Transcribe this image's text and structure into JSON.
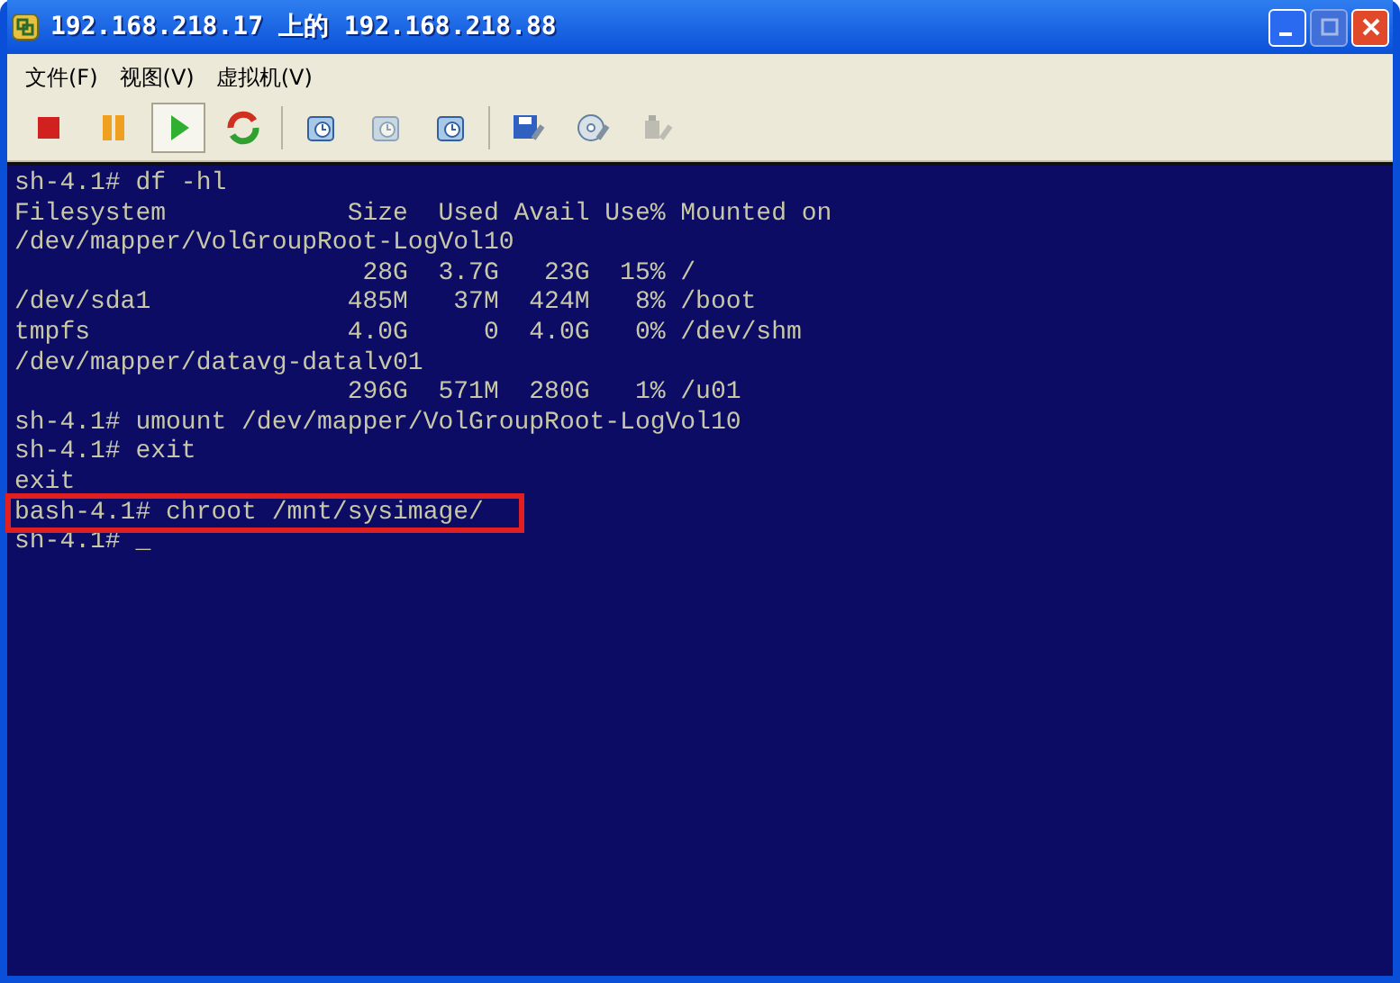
{
  "window": {
    "title": "192.168.218.17 上的 192.168.218.88"
  },
  "menu": [
    "文件(F)",
    "视图(V)",
    "虚拟机(V)"
  ],
  "toolbar": [
    {
      "kind": "stop",
      "selected": false,
      "disabled": false
    },
    {
      "kind": "pause",
      "selected": false,
      "disabled": false
    },
    {
      "kind": "play",
      "selected": true,
      "disabled": false
    },
    {
      "kind": "reset",
      "selected": false,
      "disabled": false
    },
    {
      "kind": "snapshot",
      "selected": false,
      "disabled": false
    },
    {
      "kind": "revert",
      "selected": false,
      "disabled": true
    },
    {
      "kind": "manage",
      "selected": false,
      "disabled": false
    },
    {
      "kind": "floppy",
      "selected": false,
      "disabled": false
    },
    {
      "kind": "cdrom",
      "selected": false,
      "disabled": false
    },
    {
      "kind": "usb",
      "selected": false,
      "disabled": true
    }
  ],
  "terminal": {
    "lines": [
      {
        "text": "sh-4.1# df -hl",
        "highlighted": false
      },
      {
        "text": "Filesystem            Size  Used Avail Use% Mounted on",
        "highlighted": false
      },
      {
        "text": "/dev/mapper/VolGroupRoot-LogVol10",
        "highlighted": false
      },
      {
        "text": "                       28G  3.7G   23G  15% /",
        "highlighted": false
      },
      {
        "text": "/dev/sda1             485M   37M  424M   8% /boot",
        "highlighted": false
      },
      {
        "text": "tmpfs                 4.0G     0  4.0G   0% /dev/shm",
        "highlighted": false
      },
      {
        "text": "/dev/mapper/datavg-datalv01",
        "highlighted": false
      },
      {
        "text": "                      296G  571M  280G   1% /u01",
        "highlighted": false
      },
      {
        "text": "sh-4.1# umount /dev/mapper/VolGroupRoot-LogVol10",
        "highlighted": false
      },
      {
        "text": "sh-4.1# exit",
        "highlighted": false
      },
      {
        "text": "exit",
        "highlighted": false
      },
      {
        "text": "bash-4.1# chroot /mnt/sysimage/",
        "highlighted": true
      },
      {
        "text": "sh-4.1# _",
        "highlighted": false
      }
    ]
  }
}
